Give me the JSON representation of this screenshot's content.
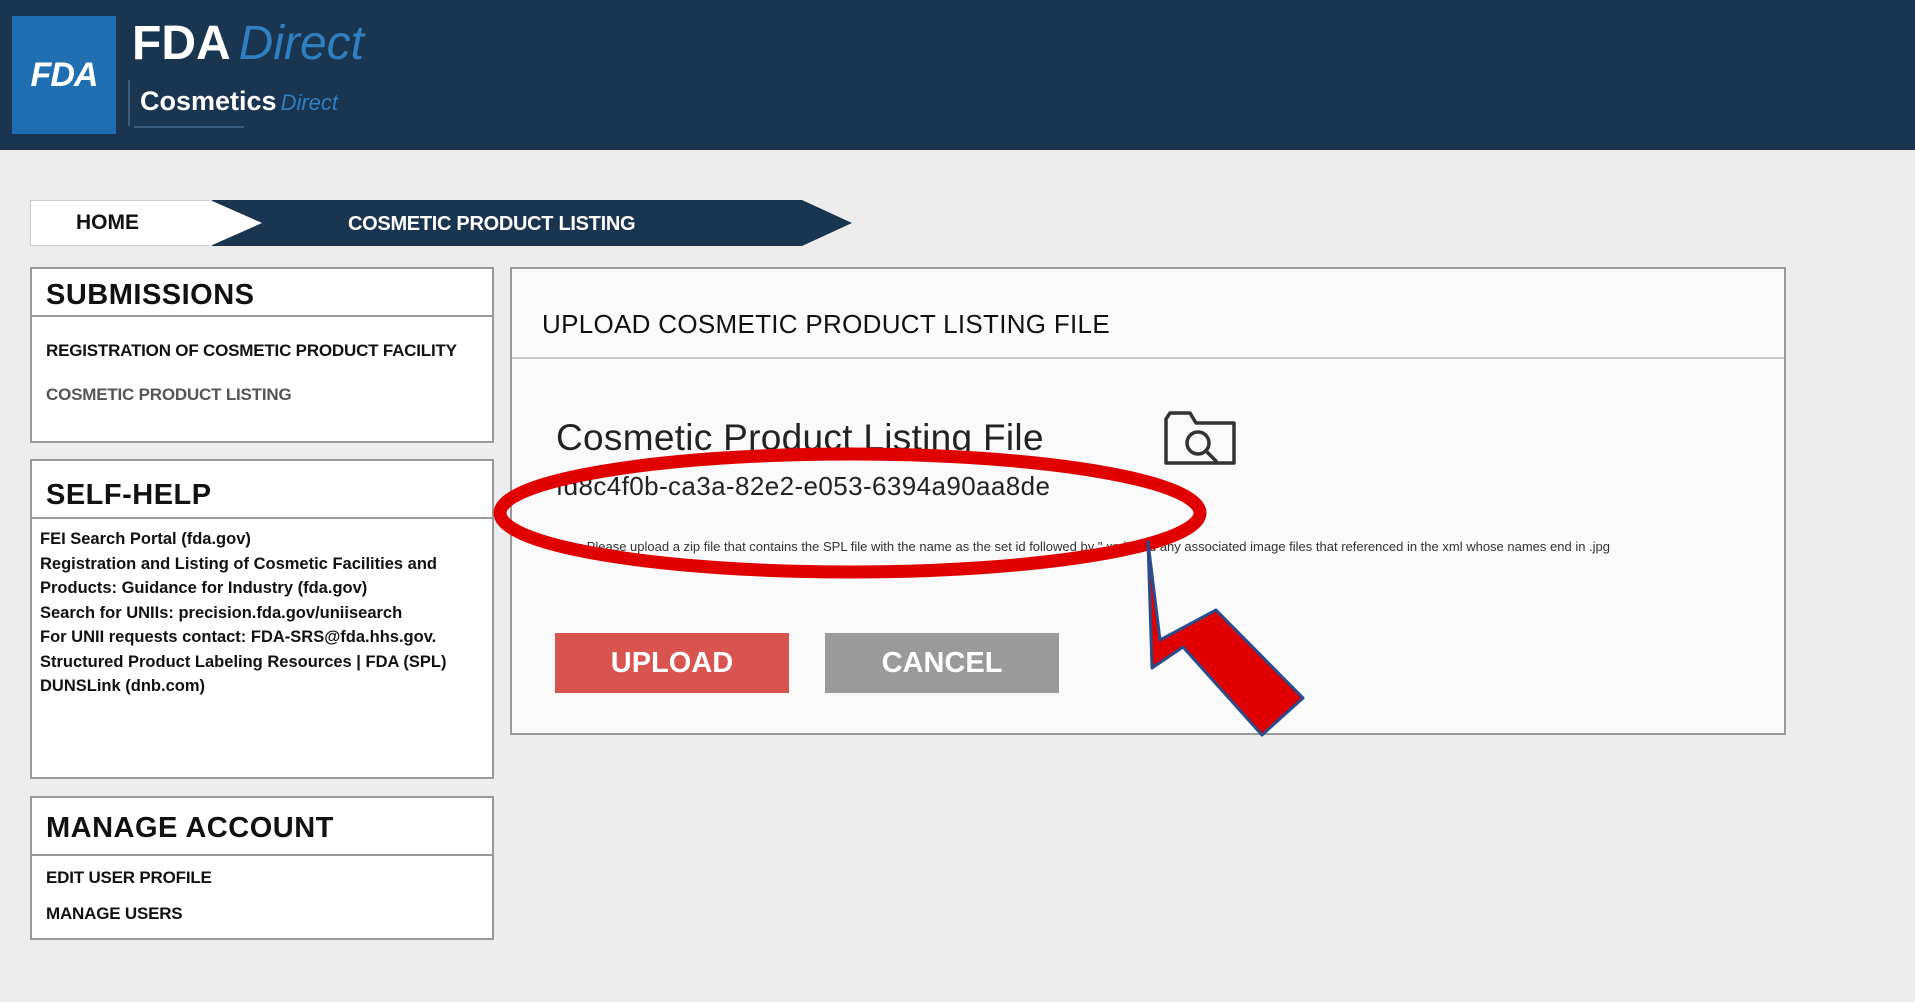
{
  "header": {
    "logo_text": "FDA",
    "brand_title": "FDA",
    "brand_title_accent": "Direct",
    "brand_sub": "Cosmetics",
    "brand_sub_accent": "Direct"
  },
  "breadcrumb": {
    "home": "HOME",
    "current": "COSMETIC PRODUCT LISTING"
  },
  "sidebar": {
    "submissions": {
      "title": "SUBMISSIONS",
      "items": [
        {
          "label": "REGISTRATION OF COSMETIC PRODUCT FACILITY"
        },
        {
          "label": "COSMETIC PRODUCT LISTING"
        }
      ]
    },
    "self_help": {
      "title": "SELF-HELP",
      "items": [
        {
          "label": "FEI Search Portal (fda.gov)"
        },
        {
          "label": "Registration and Listing of Cosmetic Facilities and Products: Guidance for Industry (fda.gov)"
        },
        {
          "label": "Search for UNIIs: precision.fda.gov/uniisearch"
        },
        {
          "label": "For UNII requests contact:  FDA-SRS@fda.hhs.gov."
        },
        {
          "label": "Structured Product Labeling Resources | FDA (SPL)"
        },
        {
          "label": "DUNSLink (dnb.com)"
        }
      ]
    },
    "manage_account": {
      "title": "MANAGE ACCOUNT",
      "items": [
        {
          "label": "EDIT USER PROFILE"
        },
        {
          "label": "MANAGE USERS"
        }
      ]
    }
  },
  "main": {
    "card_title": "UPLOAD COSMETIC PRODUCT LISTING FILE",
    "field_label": "Cosmetic Product Listing File",
    "file_name": "fd8c4f0b-ca3a-82e2-e053-6394a90aa8de",
    "note": "Note: Please upload a zip file that contains the SPL file with the name as the set id followed by \".xml\" and any associated image files that referenced in the xml whose names end in .jpg",
    "upload_label": "UPLOAD",
    "cancel_label": "CANCEL"
  },
  "colors": {
    "header_bg": "#1a3550",
    "upload_button": "#d9534f",
    "cancel_button": "#9a9a9a",
    "annotation": "#e00000"
  },
  "icons": {
    "browse": "folder-search-icon"
  }
}
